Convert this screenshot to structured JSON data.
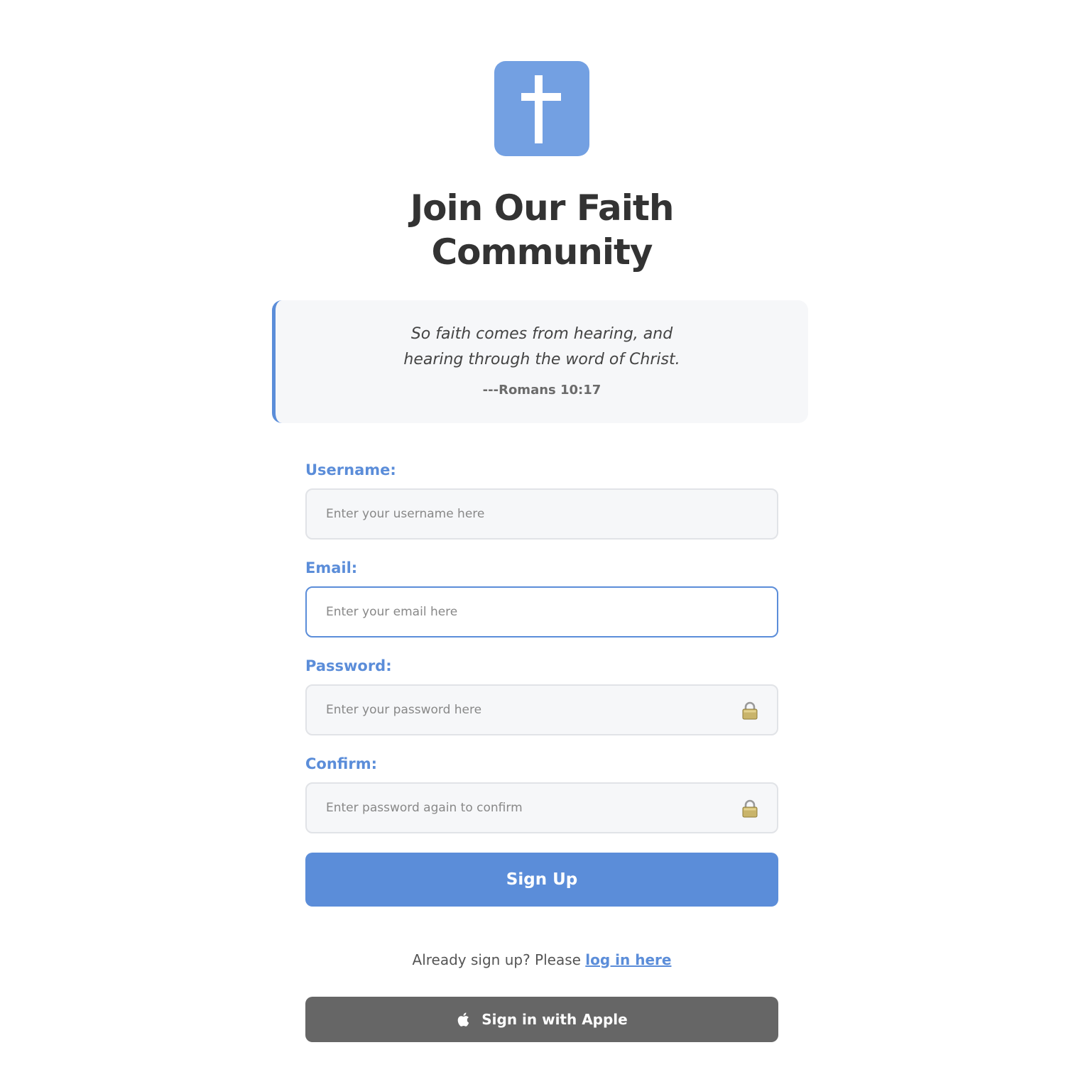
{
  "header": {
    "logo_icon": "cross-icon",
    "title": "Join Our Faith Community"
  },
  "verse": {
    "line1": "So faith comes from hearing, and",
    "line2": "hearing through the word of Christ.",
    "reference": "---Romans 10:17"
  },
  "form": {
    "username": {
      "label": "Username:",
      "value": "",
      "placeholder": "Enter your username here"
    },
    "email": {
      "label": "Email:",
      "value": "",
      "placeholder": "Enter your email here"
    },
    "password": {
      "label": "Password:",
      "value": "",
      "placeholder": "Enter your password here",
      "icon": "lock-icon"
    },
    "confirm": {
      "label": "Confirm:",
      "value": "",
      "placeholder": "Enter password again to confirm",
      "icon": "lock-icon"
    },
    "submit_label": "Sign Up"
  },
  "footer": {
    "already_text": "Already sign up? Please ",
    "login_link": "log in here",
    "apple_label": "Sign in with Apple",
    "apple_icon": "apple-icon"
  },
  "colors": {
    "accent": "#5b8dd9",
    "logo_bg": "#73a0e2",
    "apple_button": "#666666"
  }
}
